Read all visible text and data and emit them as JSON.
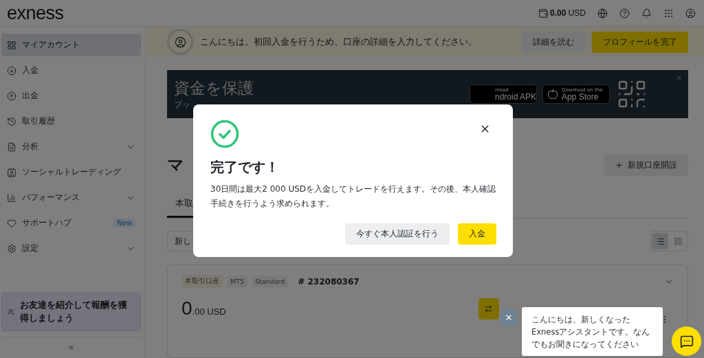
{
  "header": {
    "logo": "exness",
    "balance": {
      "amount": "0.00",
      "currency": "USD"
    }
  },
  "sidebar": {
    "items": [
      {
        "label": "マイアカウント",
        "selected": true,
        "expandable": false
      },
      {
        "label": "入金",
        "selected": false,
        "expandable": false
      },
      {
        "label": "出金",
        "selected": false,
        "expandable": false
      },
      {
        "label": "取引履歴",
        "selected": false,
        "expandable": false
      },
      {
        "label": "分析",
        "selected": false,
        "expandable": true
      },
      {
        "label": "ソーシャルトレーディング",
        "selected": false,
        "expandable": false
      },
      {
        "label": "パフォーマンス",
        "selected": false,
        "expandable": true
      },
      {
        "label": "サポートハブ",
        "selected": false,
        "expandable": false,
        "badge": "New"
      },
      {
        "label": "設定",
        "selected": false,
        "expandable": true
      }
    ],
    "referral": "お友達を紹介して報酬を獲得しましょう",
    "collapse": "«"
  },
  "notice": {
    "text": "こんにちは。初回入金を行うため、口座の詳細を入力してください。",
    "buttons": [
      {
        "label": "詳細を読む",
        "kind": "secondary"
      },
      {
        "label": "プロフィールを完了",
        "kind": "primary"
      }
    ]
  },
  "promo": {
    "title": "資金を保護",
    "subtitle": "ブッ",
    "stores": [
      {
        "kind": "android",
        "line1": "nload",
        "line2": "ndroid APK"
      },
      {
        "kind": "apple",
        "line1": "Download on the",
        "line2": "App Store"
      }
    ]
  },
  "page": {
    "heading": "マ",
    "new_account": "新規口座開設",
    "tabs": [
      {
        "label": "本取",
        "selected": true
      }
    ],
    "sort": "新し",
    "views": [
      {
        "kind": "list",
        "selected": true
      },
      {
        "kind": "grid",
        "selected": false
      }
    ]
  },
  "account": {
    "tags": [
      {
        "label": "本取引口座",
        "kind": "warm"
      },
      {
        "label": "MT5",
        "kind": "plain"
      },
      {
        "label": "Standard",
        "kind": "plain"
      }
    ],
    "number": "# 232080367",
    "balance_int": "0",
    "balance_rest": ".00 USD"
  },
  "dialog": {
    "title": "完了です！",
    "message": "30日間は最大2 000 USDを入金してトレードを行えます。その後、本人確認手続きを行うよう求められます。",
    "buttons": [
      {
        "label": "今すぐ本人認証を行う",
        "kind": "secondary"
      },
      {
        "label": "入金",
        "kind": "primary"
      }
    ]
  },
  "chat": {
    "message": "こんにちは、新しくなったExnessアシスタントです。なんでもお聞きになってください"
  }
}
